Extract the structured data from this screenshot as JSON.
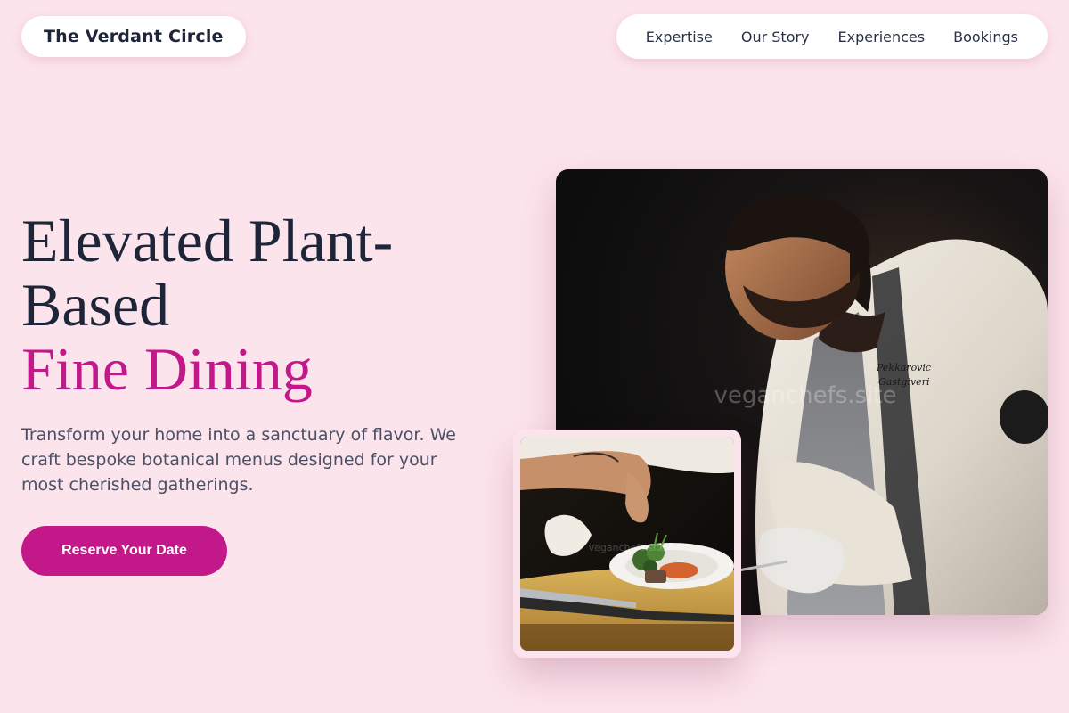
{
  "header": {
    "brand": "The Verdant Circle",
    "nav": [
      {
        "label": "Expertise"
      },
      {
        "label": "Our Story"
      },
      {
        "label": "Experiences"
      },
      {
        "label": "Bookings"
      }
    ]
  },
  "hero": {
    "title_line1": "Elevated Plant-",
    "title_line2": "Based",
    "title_accent": "Fine Dining",
    "description": "Transform your home into a sanctuary of flavor. We craft bespoke botanical menus designed for your most cherished gatherings.",
    "cta_label": "Reserve Your Date"
  },
  "images": {
    "main_watermark": "veganchefs.site",
    "inset_watermark": "veganchefs.site"
  },
  "colors": {
    "background": "#fce4ec",
    "accent": "#c2188a",
    "text": "#1e2538"
  }
}
